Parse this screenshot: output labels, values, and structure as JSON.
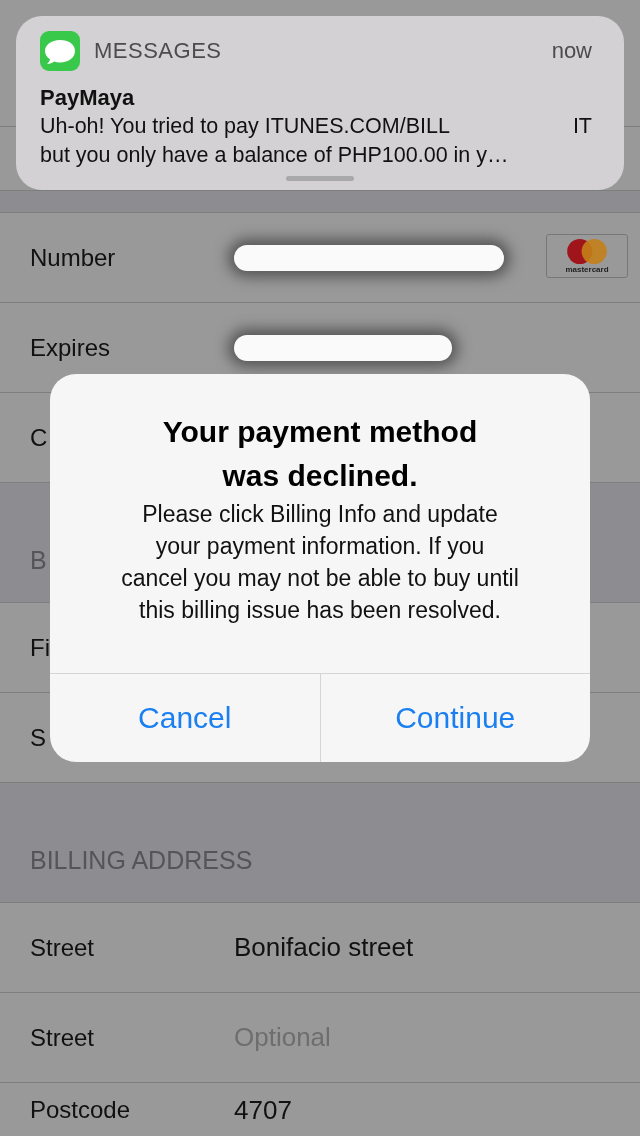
{
  "notification": {
    "app": "MESSAGES",
    "time": "now",
    "sender": "PayMaya",
    "body_lines": [
      [
        "Uh-oh! You tried to pay ITUNES.COM/BILL",
        "IT"
      ],
      [
        "but you only have a balance of PHP100.00 in y…"
      ]
    ]
  },
  "sections": [
    {
      "rows": [
        {
          "label": "Number",
          "kind": "redacted",
          "brand": "mastercard"
        },
        {
          "label": "Expires",
          "kind": "redacted"
        },
        {
          "label": "C",
          "kind": "text"
        }
      ]
    },
    {
      "header": "B",
      "rows": [
        {
          "label": "Fi",
          "kind": "text"
        },
        {
          "label": "S",
          "kind": "text"
        }
      ]
    },
    {
      "header": "BILLING ADDRESS",
      "rows": [
        {
          "label": "Street",
          "kind": "text",
          "value": "Bonifacio street"
        },
        {
          "label": "Street",
          "kind": "text",
          "placeholder": "Optional"
        },
        {
          "label": "Postcode",
          "kind": "text",
          "value": "4707"
        }
      ]
    }
  ],
  "alert": {
    "title": "Your payment method\nwas declined.",
    "message": "Please click Billing Info and update\nyour payment information. If you\ncancel you may not be able to buy until\nthis billing issue has been resolved.",
    "buttons": [
      "Cancel",
      "Continue"
    ]
  }
}
